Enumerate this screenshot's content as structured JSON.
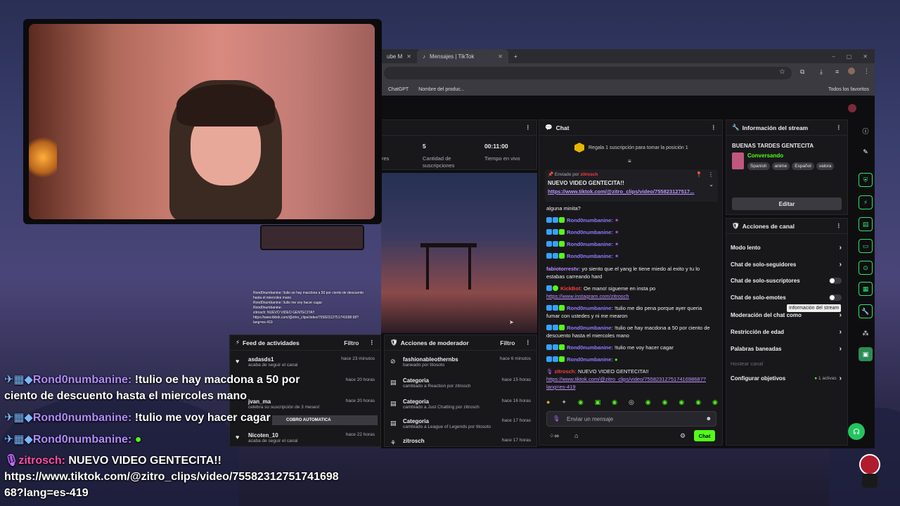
{
  "browser": {
    "tabs": [
      {
        "label": "ube M",
        "active": false
      },
      {
        "label": "Mensajes | TikTok",
        "active": true
      }
    ],
    "bookmarks": [
      "ChatGPT",
      "Nombre del produc..."
    ],
    "bookmarks_right": "Todos los favoritos"
  },
  "stats": {
    "label_left": "res",
    "subs_value": "5",
    "subs_label": "Cantidad de suscripciones",
    "live_value": "00:11:00",
    "live_label": "Tiempo en vivo"
  },
  "preview_chat": [
    "Rond0numbanine: !tulio oe hay macdona a 50 por ciento de descuento hasta el miercoles mano",
    "Rond0numbanine: !tulio me voy hacer cagar",
    "Rond0numbanine:",
    "zitrosch: NUEVO VIDEO GENTECITA!! https://www.tiktok.com/@zitro_clips/video/75582312751741698 68?lang=es-419"
  ],
  "activity_feed": {
    "title": "Feed de actividades",
    "filter": "Filtro",
    "items": [
      {
        "name": "asdasds1",
        "sub": "acaba de seguir el canal",
        "time": "hace 23 minutos"
      },
      {
        "name": "",
        "sub": "",
        "time": "hace 20 horas"
      },
      {
        "name": "jvan_ma",
        "sub": "celebra su suscripción de 3 meses!",
        "time": "hace 20 horas"
      },
      {
        "name": "Nicoten_10",
        "sub": "acaba de seguir el canal",
        "time": "hace 22 horas"
      }
    ],
    "promo": "COBRO AUTOMATICA"
  },
  "mod_actions": {
    "title": "Acciones de moderador",
    "filter": "Filtro",
    "items": [
      {
        "name": "fashionableothernbs",
        "sub": "baneado por titosoto",
        "time": "hace 6 minutos"
      },
      {
        "name": "Categoria",
        "sub": "cambiado a Reaction por zitrosch",
        "time": "hace 15 horas"
      },
      {
        "name": "Categoria",
        "sub": "cambiado a Just Chatting por zitrosch",
        "time": "hace 16 horas"
      },
      {
        "name": "Categoria",
        "sub": "cambiado a League of Legends por titosoto",
        "time": "hace 17 horas"
      },
      {
        "name": "zitrosch",
        "sub": "",
        "time": "hace 17 horas"
      }
    ]
  },
  "chat": {
    "title": "Chat",
    "gift_prompt": "Regala 1 suscripción para tomar la posición 1",
    "pinned": {
      "sent_by": "Enviado por",
      "sender": "zitrosch",
      "title": "NUEVO VIDEO GENTECITA!!",
      "link": "https://www.tiktok.com/@zitro_clips/video/755823127517..."
    },
    "messages": [
      {
        "user": "",
        "text": "alguna minita?"
      },
      {
        "user": "Rond0numbanine:",
        "text": ""
      },
      {
        "user": "Rond0numbanine:",
        "text": ""
      },
      {
        "user": "Rond0numbanine:",
        "text": ""
      },
      {
        "user": "Rond0numbanine:",
        "text": ""
      },
      {
        "user": "fabiotorrestv:",
        "text": " yo siento que el yang le tiene miedo al exito y tu lo estabas carreando hard"
      },
      {
        "user": "KickBot:",
        "text": " Oe mano! sigueme en insta po",
        "link": "https://www.instagram.com/zitrosch"
      },
      {
        "user": "Rond0numbanine:",
        "text": " !tulio me dio pena porque ayer queria fumar con ustedes y ni me mearon"
      },
      {
        "user": "Rond0numbanine:",
        "text": " !tulio oe hay macdona a 50 por ciento de descuento hasta el miercoles mano"
      },
      {
        "user": "Rond0numbanine:",
        "text": " !tulio me voy hacer cagar"
      },
      {
        "user": "Rond0numbanine:",
        "text": ""
      },
      {
        "user": "zitrosch:",
        "text": " NUEVO VIDEO GENTECITA!!",
        "link": "https://www.tiktok.com/@zitro_clips/video/75582312751741698687?lang=es-419"
      }
    ],
    "input_placeholder": "Enviar un mensaje",
    "send_label": "Chat"
  },
  "stream_info": {
    "title": "Información del stream",
    "stream_title": "BUENAS TARDES GENTECITA",
    "category": "Conversando",
    "tags": [
      "Spanish",
      "anime",
      "Español",
      "valora"
    ],
    "edit_label": "Editar"
  },
  "channel_actions": {
    "title": "Acciones de canal",
    "rows": [
      {
        "label": "Modo lento",
        "kind": "chevron"
      },
      {
        "label": "Chat de solo-seguidores",
        "kind": "chevron"
      },
      {
        "label": "Chat de solo-suscriptores",
        "kind": "toggle"
      },
      {
        "label": "Chat de solo-emotes",
        "kind": "toggle"
      },
      {
        "label": "Moderación del chat como",
        "kind": "chevron"
      },
      {
        "label": "Restricción de edad",
        "kind": "chevron"
      },
      {
        "label": "Palabras baneadas",
        "kind": "chevron"
      },
      {
        "label": "Hostear canal",
        "kind": "disabled"
      },
      {
        "label": "Configurar objetivos",
        "kind": "chevron",
        "extra": "1 activas"
      }
    ],
    "tooltip": "Información del stream"
  },
  "overlay": {
    "name1": "Rond0numbanine:",
    "msg1a": " !tulio oe hay macdona a 50 por",
    "msg1b": "ciento de descuento hasta el miercoles mano",
    "name2": "Rond0numbanine:",
    "msg2": " !tulio me voy hacer cagar",
    "name3": "Rond0numbanine:",
    "name4": "zitrosch:",
    "msg4": " NUEVO VIDEO GENTECITA!!",
    "link_a": "https://www.tiktok.com/@zitro_clips/video/75582312751741698",
    "link_b": "68?lang=es-419"
  },
  "colors": {
    "accent": "#53fc18",
    "name": "#b38cff"
  }
}
